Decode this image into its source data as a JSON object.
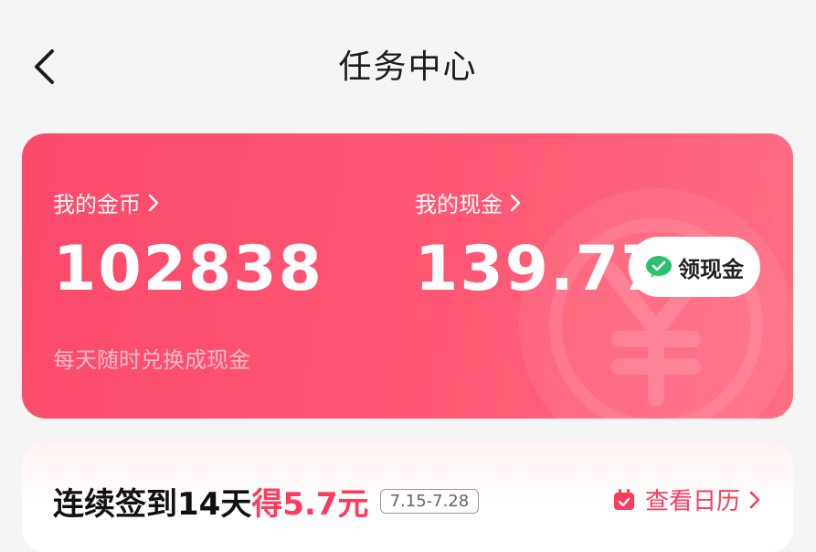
{
  "nav": {
    "title": "任务中心"
  },
  "wallet": {
    "coins_label": "我的金币",
    "coins_value": "102838",
    "cash_label": "我的现金",
    "cash_value": "139.77",
    "withdraw_label": "领现金",
    "hint": "每天随时兑换成现金"
  },
  "checkin": {
    "prefix": "连续签到14天",
    "reward": "得5.7元",
    "date_range": "7.15-7.28",
    "calendar_label": "查看日历"
  },
  "colors": {
    "accent": "#ff3b5c",
    "card": "#fb4a6a",
    "wechat": "#2cc16b"
  }
}
